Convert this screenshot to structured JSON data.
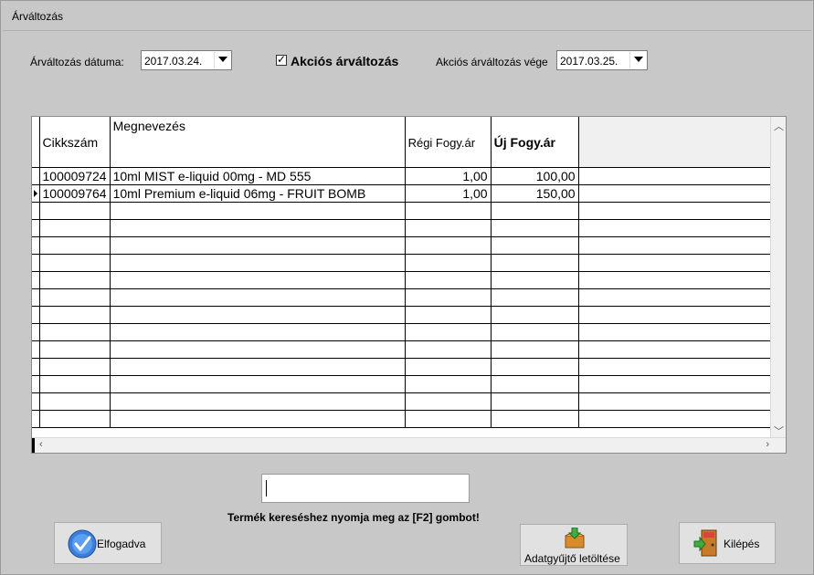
{
  "window": {
    "title": "Árváltozás"
  },
  "form": {
    "date_label": "Árváltozás dátuma:",
    "date_value": "2017.03.24.",
    "promo_checkbox_label": "Akciós árváltozás",
    "promo_checked": true,
    "promo_end_label": "Akciós árváltozás vége",
    "promo_end_value": "2017.03.25."
  },
  "grid": {
    "columns": [
      "Cikkszám",
      "Megnevezés",
      "Régi Fogy.ár",
      "Új Fogy.ár"
    ],
    "rows": [
      {
        "code": "100009724",
        "name": "10ml MIST e-liquid 00mg - MD 555",
        "old_price": "1,00",
        "new_price": "100,00"
      },
      {
        "code": "100009764",
        "name": "10ml Premium e-liquid 06mg - FRUIT BOMB",
        "old_price": "1,00",
        "new_price": "150,00"
      }
    ],
    "current_row_index": 1
  },
  "search": {
    "value": "",
    "hint": "Termék kereséshez nyomja meg az [F2] gombot!"
  },
  "buttons": {
    "accept": "Elfogadva",
    "download": "Adatgyűjtő letöltése",
    "exit": "Kilépés"
  },
  "icons": {
    "accept": "checkmark-circle-icon",
    "download": "package-download-icon",
    "exit": "exit-door-icon"
  }
}
